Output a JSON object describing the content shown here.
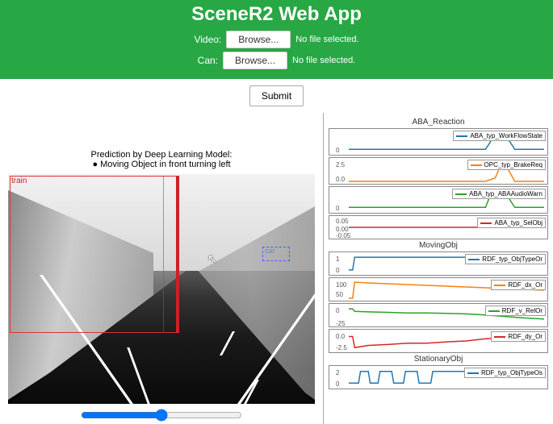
{
  "header": {
    "title": "SceneR2 Web App",
    "video_label": "Video:",
    "can_label": "Can:",
    "browse_label": "Browse...",
    "nofile_label": "No file selected.",
    "submit_label": "Submit"
  },
  "prediction": {
    "heading": "Prediction by Deep Learning Model:",
    "bullet": "● Moving Object in front turning left"
  },
  "detections": {
    "train_label": "train",
    "car_label": "car"
  },
  "sections": {
    "aba": "ABA_Reaction",
    "moving": "MovingObj",
    "stationary": "StationaryObj"
  },
  "plots": [
    {
      "id": "workflow",
      "legend": "ABA_typ_WorkFlowState",
      "color": "#1f77b4",
      "tick": "0"
    },
    {
      "id": "brakereq",
      "legend": "OPC_typ_BrakeReq",
      "color": "#ff7f0e",
      "tick": "2.5",
      "tick2": "0.0"
    },
    {
      "id": "audiowarn",
      "legend": "ABA_typ_ABAAudioWarn",
      "color": "#2ca02c",
      "tick": "0"
    },
    {
      "id": "selobj",
      "legend": "ABA_typ_SelObj",
      "color": "#d62728",
      "tick": "0.05",
      "tick2": "0.00",
      "tick3": "-0.05"
    },
    {
      "id": "objtypeor",
      "legend": "RDF_typ_ObjTypeOr",
      "color": "#1f77b4",
      "tick": "1",
      "tick2": "0"
    },
    {
      "id": "dxor",
      "legend": "RDF_dx_Or",
      "color": "#ff7f0e",
      "tick": "100",
      "tick2": "50"
    },
    {
      "id": "vrelor",
      "legend": "RDF_v_RelOr",
      "color": "#2ca02c",
      "tick": "0",
      "tick2": "-25"
    },
    {
      "id": "dyor",
      "legend": "RDF_dy_Or",
      "color": "#d62728",
      "tick": "0.0",
      "tick2": "-2.5"
    },
    {
      "id": "objtypeos",
      "legend": "RDF_typ_ObjTypeOs",
      "color": "#1f77b4",
      "tick": "2",
      "tick2": "0"
    }
  ],
  "chart_data": [
    {
      "id": "workflow",
      "type": "line",
      "title": "ABA_typ_WorkFlowState",
      "x": [
        0,
        10,
        20,
        30,
        40,
        50,
        60,
        70,
        75,
        80,
        85,
        90,
        100
      ],
      "y": [
        0,
        0,
        0,
        0,
        0,
        0,
        0,
        0,
        1,
        1,
        0,
        0,
        0
      ],
      "ylim": [
        -0.2,
        1.2
      ]
    },
    {
      "id": "brakereq",
      "type": "line",
      "title": "OPC_typ_BrakeReq",
      "x": [
        0,
        10,
        20,
        30,
        40,
        50,
        60,
        70,
        75,
        78,
        80,
        85,
        90,
        100
      ],
      "y": [
        0,
        0,
        0,
        0,
        0,
        0,
        0,
        0,
        0.5,
        2.5,
        2.5,
        0,
        0,
        0
      ],
      "ylim": [
        0,
        3
      ]
    },
    {
      "id": "audiowarn",
      "type": "line",
      "title": "ABA_typ_ABAAudioWarn",
      "x": [
        0,
        10,
        20,
        30,
        40,
        50,
        60,
        70,
        73,
        80,
        85,
        90,
        100
      ],
      "y": [
        0,
        0,
        0,
        0,
        0,
        0,
        0,
        0,
        1,
        1,
        0,
        0,
        0
      ],
      "ylim": [
        -0.2,
        1.2
      ]
    },
    {
      "id": "selobj",
      "type": "line",
      "title": "ABA_typ_SelObj",
      "x": [
        0,
        100
      ],
      "y": [
        0,
        0
      ],
      "ylim": [
        -0.05,
        0.05
      ]
    },
    {
      "id": "objtypeor",
      "type": "line",
      "title": "RDF_typ_ObjTypeOr",
      "x": [
        0,
        2,
        3,
        100
      ],
      "y": [
        0,
        0,
        1,
        1
      ],
      "ylim": [
        -0.2,
        1.2
      ]
    },
    {
      "id": "dxor",
      "type": "line",
      "title": "RDF_dx_Or",
      "x": [
        0,
        2,
        3,
        10,
        20,
        30,
        40,
        50,
        60,
        70,
        80,
        90,
        100
      ],
      "y": [
        0,
        0,
        100,
        95,
        90,
        85,
        80,
        75,
        70,
        65,
        60,
        55,
        50
      ],
      "ylim": [
        0,
        110
      ]
    },
    {
      "id": "vrelor",
      "type": "line",
      "title": "RDF_v_RelOr",
      "x": [
        0,
        2,
        3,
        10,
        20,
        30,
        40,
        50,
        60,
        70,
        80,
        90,
        100
      ],
      "y": [
        0,
        0,
        -5,
        -6,
        -7,
        -8,
        -8,
        -9,
        -10,
        -12,
        -15,
        -18,
        -20
      ],
      "ylim": [
        -30,
        5
      ]
    },
    {
      "id": "dyor",
      "type": "line",
      "title": "RDF_dy_Or",
      "x": [
        0,
        2,
        3,
        10,
        20,
        30,
        40,
        50,
        60,
        70,
        80,
        85,
        90,
        95,
        100
      ],
      "y": [
        0,
        0,
        -2.5,
        -2.0,
        -1.8,
        -1.5,
        -1.5,
        -1.2,
        -1.0,
        -0.5,
        -0.3,
        0.2,
        -0.2,
        0.3,
        0.0
      ],
      "ylim": [
        -3,
        1
      ]
    },
    {
      "id": "objtypeos",
      "type": "line",
      "title": "RDF_typ_ObjTypeOs",
      "x": [
        0,
        5,
        6,
        10,
        11,
        15,
        16,
        22,
        23,
        28,
        29,
        35,
        36,
        42,
        43,
        100
      ],
      "y": [
        0,
        0,
        2,
        2,
        0,
        0,
        2,
        2,
        0,
        0,
        2,
        2,
        0,
        0,
        2,
        2
      ],
      "ylim": [
        -0.5,
        2.5
      ]
    }
  ]
}
